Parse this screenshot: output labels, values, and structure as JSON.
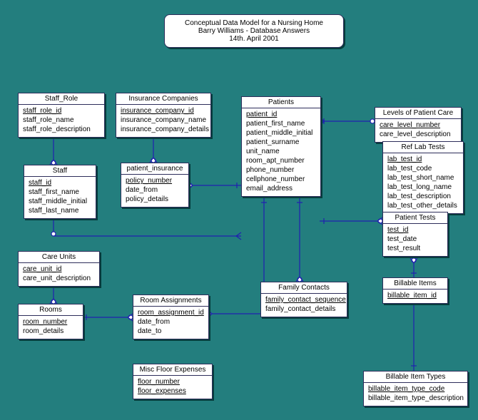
{
  "title": {
    "line1": "Conceptual Data Model for a Nursing Home",
    "line2": "Barry Williams - Database Answers",
    "line3": "14th. April 2001"
  },
  "entities": {
    "staff_role": {
      "name": "Staff_Role",
      "fields": [
        "staff_role_id",
        "staff_role_name",
        "staff_role_description"
      ]
    },
    "insurance_companies": {
      "name": "Insurance Companies",
      "fields": [
        "insurance_company_id",
        "insurance_company_name",
        "insurance_company_details"
      ]
    },
    "patients": {
      "name": "Patients",
      "fields": [
        "patient_id",
        "patient_first_name",
        "patient_middle_initial",
        "patient_surname",
        "unit_name",
        "room_apt_number",
        "phone_number",
        "cellphone_number",
        "email_address"
      ]
    },
    "levels_of_patient_care": {
      "name": "Levels of Patient Care",
      "fields": [
        "care_level_number",
        "care_level_description"
      ]
    },
    "staff": {
      "name": "Staff",
      "fields": [
        "staff_id",
        "staff_first_name",
        "staff_middle_initial",
        "staff_last_name"
      ]
    },
    "patient_insurance": {
      "name": "patient_insurance",
      "fields": [
        "policy_number",
        "date_from",
        "policy_details"
      ]
    },
    "ref_lab_tests": {
      "name": "Ref Lab Tests",
      "fields": [
        "lab_test_id",
        "lab_test_code",
        "lab_test_short_name",
        "lab_test_long_name",
        "lab_test_description",
        "lab_test_other_details"
      ]
    },
    "patient_tests": {
      "name": "Patient Tests",
      "fields": [
        "test_id",
        "test_date",
        "test_result"
      ]
    },
    "care_units": {
      "name": "Care Units",
      "fields": [
        "care_unit_id",
        "care_unit_description"
      ]
    },
    "rooms": {
      "name": "Rooms",
      "fields": [
        "room_number",
        "room_details"
      ]
    },
    "room_assignments": {
      "name": "Room Assignments",
      "fields": [
        "room_assignment_id",
        "date_from",
        "date_to"
      ]
    },
    "family_contacts": {
      "name": "Family Contacts",
      "fields": [
        "family_contact_sequence",
        "family_contact_details"
      ]
    },
    "billable_items": {
      "name": "Billable Items",
      "fields": [
        "billable_item_id"
      ]
    },
    "misc_floor_expenses": {
      "name": "Misc Floor Expenses",
      "fields": [
        "floor_number",
        "floor_expenses"
      ]
    },
    "billable_item_types": {
      "name": "Billable Item Types",
      "fields": [
        "billable_item_type_code",
        "billable_item_type_description"
      ]
    }
  }
}
